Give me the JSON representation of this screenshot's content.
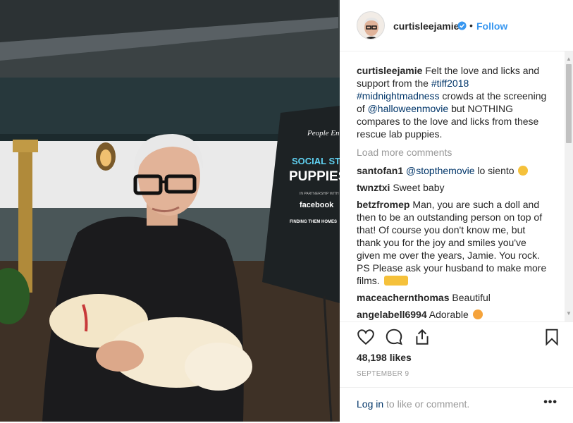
{
  "post": {
    "username": "curtisleejamie",
    "dot": "•",
    "follow_label": "Follow"
  },
  "caption": {
    "username": "curtisleejamie",
    "text1": " Felt the love and licks and support from the ",
    "tag1": "#tiff2018",
    "tag2": "#midnightmadness",
    "text2": " crowds at the screening of ",
    "mention1": "@halloweenmovie",
    "text3": " but NOTHING compares to the love and licks from these rescue lab puppies."
  },
  "load_more": "Load more comments",
  "comments": [
    {
      "user": "santofan1",
      "mention": "@stopthemovie",
      "text": " lo siento",
      "emoji": "astonished-emoji"
    },
    {
      "user": "twnztxi",
      "mention": "",
      "text": " Sweet baby",
      "emoji": ""
    },
    {
      "user": "betzfromep",
      "mention": "",
      "text": " Man, you are such a doll and then to be an outstanding person on top of that! Of course you don't know me, but thank you for the joy and smiles you've given me over the years, Jamie. You rock. PS Please ask your husband to make more films.",
      "emoji": "hands-emoji"
    },
    {
      "user": "maceachernthomas",
      "mention": "",
      "text": " Beautiful",
      "emoji": ""
    },
    {
      "user": "angelabell6994",
      "mention": "",
      "text": " Adorable",
      "emoji": "smile-emoji"
    }
  ],
  "stats": {
    "likes": "48,198 likes",
    "date": "SEPTEMBER 9"
  },
  "add_comment": {
    "login_link": "Log in",
    "login_rest": " to like or comment.",
    "more_label": "•••"
  },
  "photo_sign": {
    "brand": "People Entert",
    "title1": "SOCIAL STU",
    "title2": "PUPPIES",
    "partner": "IN PARTNERSHIP WITH",
    "fb": "facebook",
    "ftm": "FINDING THEM HOMES"
  },
  "colors": {
    "link": "#3897f0",
    "tag": "#003569",
    "text": "#262626",
    "muted": "#999999"
  },
  "icons": [
    "heart-icon",
    "comment-icon",
    "share-icon",
    "bookmark-icon",
    "verified-badge-icon"
  ]
}
